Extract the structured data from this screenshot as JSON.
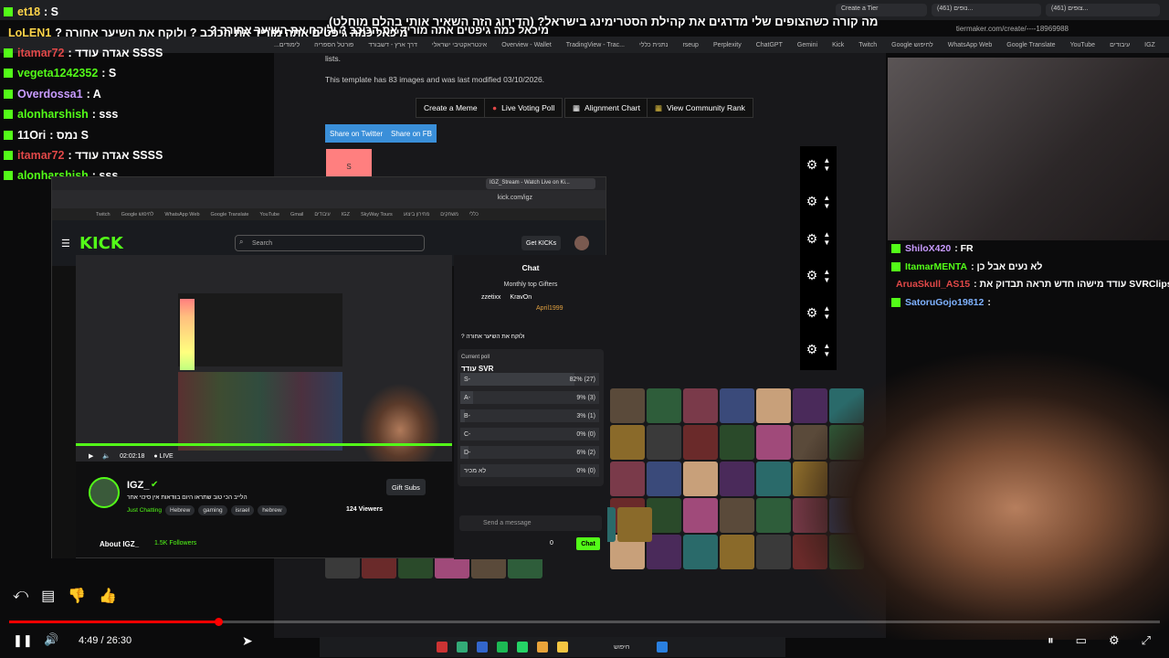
{
  "headline": {
    "line1": "מה קורה כשהצופים שלי מדרגים את קהילת הסטרימינג בישראל? (הדירוג הזה השאיר אותי בהלם מוחלט)",
    "line2": "? מיכאל כמה גיפטים אתה מוריד את הכוכב ? ולוקח את השיער אחורה"
  },
  "browser": {
    "url": "tiermaker.com/create/----18969988",
    "tabs": [
      "Create a Tier",
      "(461) נופים...",
      "(461) צופים..."
    ],
    "bookmarks": [
      "...לימודים",
      "פורטל הספריה",
      "דרך ארץ - דשבורד",
      "אינטראקטיבי ישראלי",
      "Overview - Wallet",
      "TradingView - Trac...",
      "נתנית כללי",
      "rseup",
      "Perplexity",
      "ChatGPT",
      "Gemini",
      "Kick",
      "Twitch",
      "Google לחיפוש",
      "WhatsApp Web",
      "Google Translate",
      "YouTube",
      "עיבודים",
      "IGZ",
      "SkyWay Tours",
      "מחירון ביצוע",
      "ציונים",
      "כללי"
    ]
  },
  "tiermaker": {
    "lists_text": "lists.",
    "info": "This template has 83 images and was last modified 03/10/2026.",
    "buttons": [
      "Create a Meme",
      "Live Voting Poll",
      "Alignment Chart",
      "View Community Rank"
    ],
    "share": [
      "Share on Twitter",
      "Share on FB"
    ],
    "tier_s": "S"
  },
  "left_chat": [
    {
      "user": "et18",
      "msg": ": S",
      "color": "#ffd54a"
    },
    {
      "user": "LoLEN1",
      "msg": "? מיכאל כמה גיפטים אתה מוריד את הכוכב ? ולוקח את השיער אחורה",
      "color": "#ffd54a"
    },
    {
      "user": "itamar72",
      "msg": ": אגדה עודד SSSS",
      "color": "#e04848"
    },
    {
      "user": "vegeta1242352",
      "msg": ": S",
      "color": "#53fc18"
    },
    {
      "user": "Overdossa1",
      "msg": ": A",
      "color": "#c89bff"
    },
    {
      "user": "alonharshish",
      "msg": ": sss",
      "color": "#53fc18"
    },
    {
      "user": "11Ori",
      "msg": ": נמס S",
      "color": "#ffffff"
    },
    {
      "user": "itamar72",
      "msg": ": אגדה עודד SSSS",
      "color": "#e04848"
    },
    {
      "user": "alonharshish",
      "msg": ": sss",
      "color": "#53fc18"
    }
  ],
  "right_chat": [
    {
      "user": "ShiloX420",
      "msg": ": FR",
      "color": "#c89bff"
    },
    {
      "user": "ItamarMENTA",
      "msg": ": לא נעים אבל כן",
      "color": "#53fc18"
    },
    {
      "user": "AruaSkull_AS15",
      "msg": ": עודד מישהו חדש תראה תבדוק את SVRClips",
      "color": "#e04848"
    },
    {
      "user": "SatoruGojo19812",
      "msg": ":",
      "color": "#7fb2ff"
    }
  ],
  "kick_window": {
    "tab_title": "IGZ_Stream - Watch Live on Ki...",
    "url": "kick.com/igz",
    "bookmarks": [
      "Twitch",
      "Google לחיפוש",
      "WhatsApp Web",
      "Google Translate",
      "YouTube",
      "Gmail",
      "עיבודים",
      "IGZ",
      "SkyWay Tours",
      "מחירון ביצוע",
      "משחקים",
      "כללי"
    ],
    "logo": "KICK",
    "search_placeholder": "Search",
    "get_kicks": "Get KICKs",
    "video_time": "02:02:18",
    "live_label": "LIVE",
    "streamer": "IGZ_",
    "stream_title": "הלייב הכי טוב שתראו היום בוודאות אין סיכוי אחר",
    "category": "Just Chatting",
    "tags": [
      "Hebrew",
      "gaming",
      "israel",
      "hebrew"
    ],
    "viewers": "124 Viewers",
    "gift_subs": "Gift Subs",
    "about": "About IGZ_",
    "followers": "1.5K Followers",
    "chat": {
      "title": "Chat",
      "top_gifters_label": "Monthly top Gifters",
      "gifters": [
        {
          "name": "zzetixx",
          "count": "5"
        },
        {
          "name": "KravOn",
          "count": "5"
        },
        {
          "name": "April1999",
          "count": "2"
        }
      ],
      "pinned": "? ולוקח את השיער אחורה",
      "poll": {
        "label": "Current poll",
        "title": "עודד SVR",
        "options": [
          {
            "label": "S-",
            "pct": "82%",
            "votes": "(27)",
            "fill": 0.82
          },
          {
            "label": "A-",
            "pct": "9%",
            "votes": "(3)",
            "fill": 0.09
          },
          {
            "label": "B-",
            "pct": "3%",
            "votes": "(1)",
            "fill": 0.03
          },
          {
            "label": "C-",
            "pct": "0%",
            "votes": "(0)",
            "fill": 0.0
          },
          {
            "label": "D-",
            "pct": "6%",
            "votes": "(2)",
            "fill": 0.06
          },
          {
            "label": "לא מכיר",
            "pct": "0%",
            "votes": "(0)",
            "fill": 0.0
          }
        ]
      },
      "send_placeholder": "Send a message",
      "points": "0",
      "chat_button": "Chat"
    }
  },
  "player": {
    "time": "4:49 / 26:30",
    "progress": 0.182
  },
  "taskbar": {
    "search": "חיפוש"
  },
  "colors": {
    "kick_green": "#53fc18",
    "youtube_red": "#ff0000",
    "share_blue": "#3a8fd9"
  }
}
